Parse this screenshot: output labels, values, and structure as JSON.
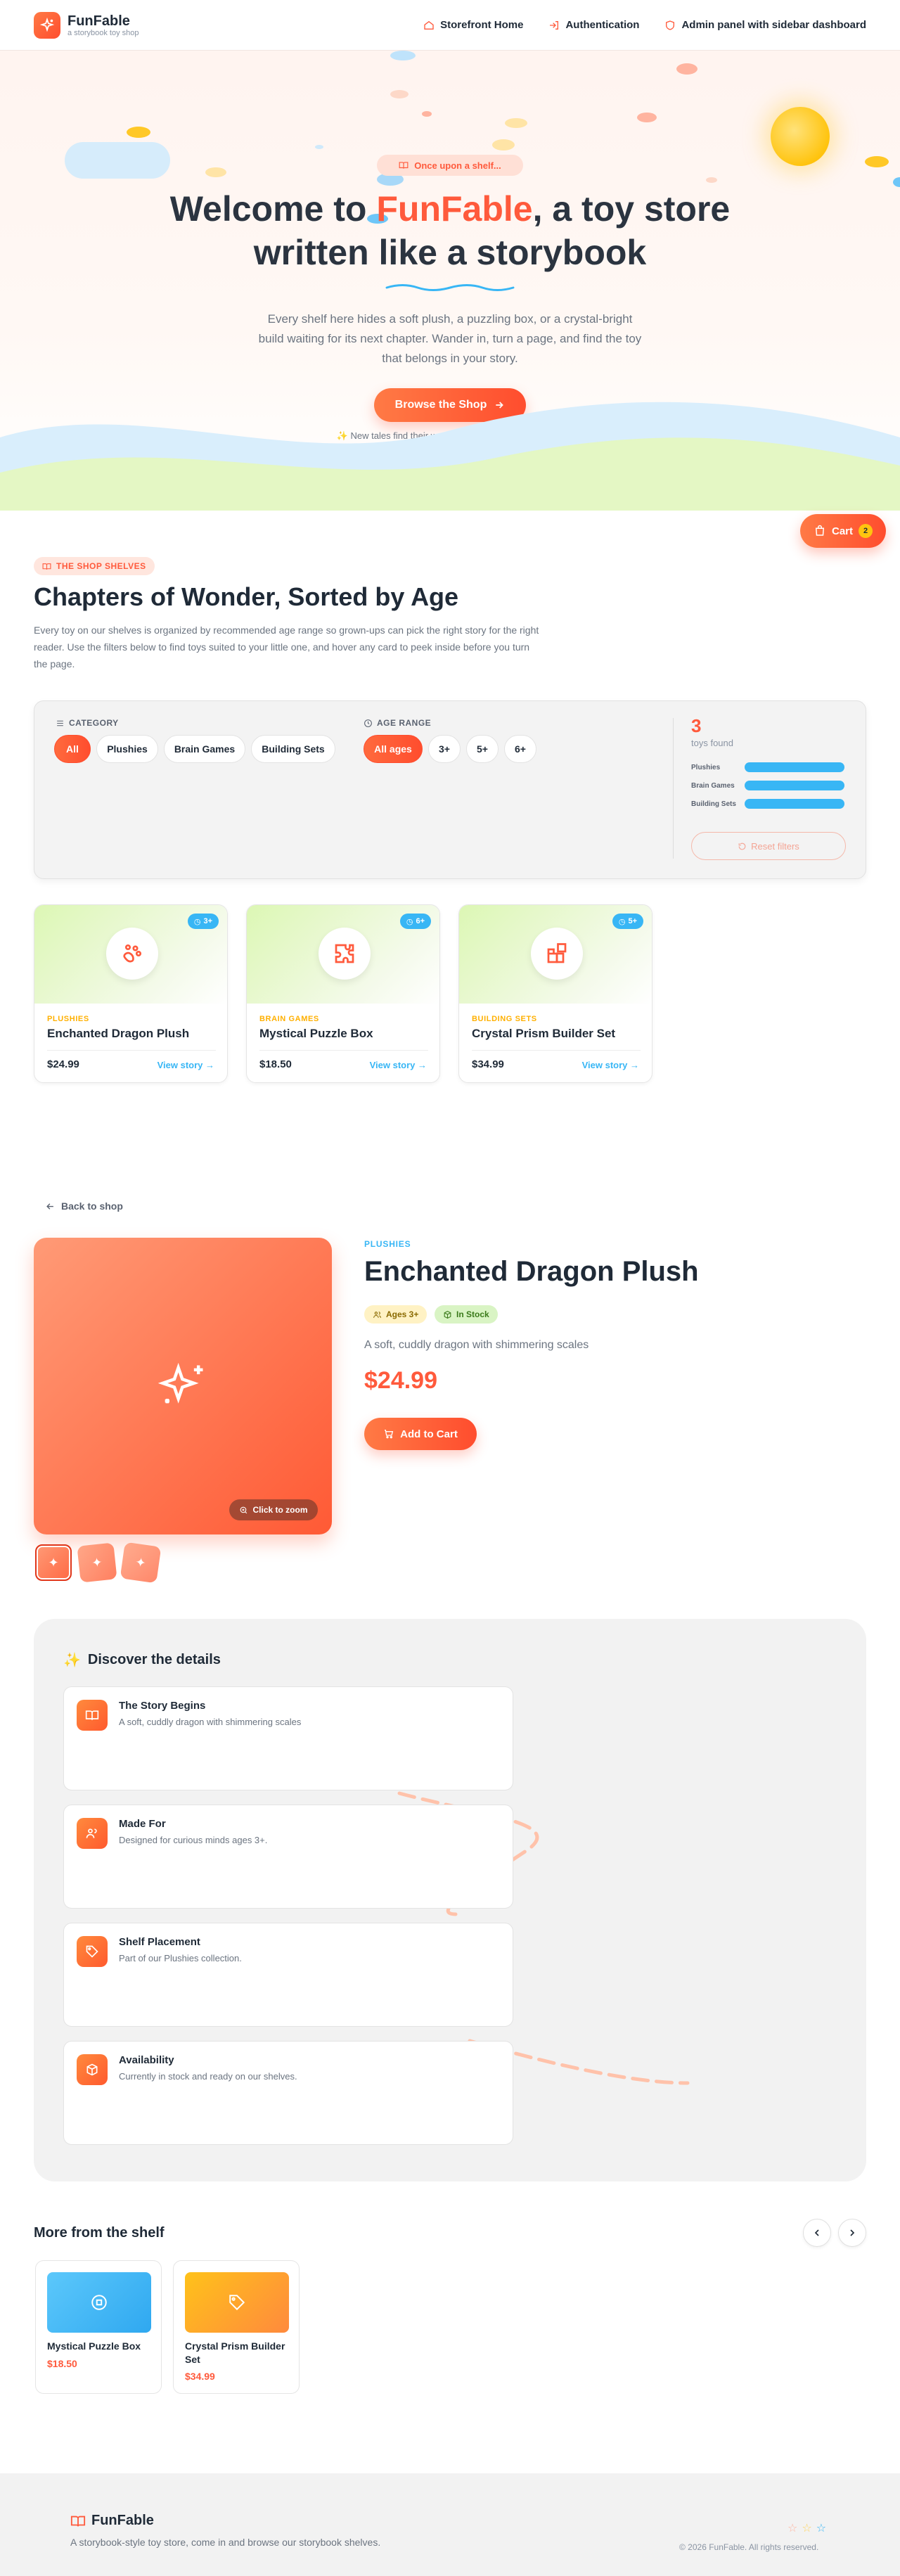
{
  "nav": {
    "brand_name": "FunFable",
    "brand_tag": "a storybook toy shop",
    "links": [
      "Storefront Home",
      "Authentication",
      "Admin panel with sidebar dashboard"
    ]
  },
  "hero": {
    "pill": "Once upon a shelf...",
    "title_pre": "Welcome to ",
    "title_accent": "FunFable",
    "title_post": ", a toy store written like a storybook",
    "subtitle": "Every shelf here hides a soft plush, a puzzling box, or a crystal-bright build waiting for its next chapter. Wander in, turn a page, and find the toy that belongs in your story.",
    "button": "Browse the Shop",
    "note": "New tales find their way to our shelves every season"
  },
  "cart": {
    "label": "Cart",
    "count": "2"
  },
  "shelves": {
    "pill": "THE SHOP SHELVES",
    "title": "Chapters of Wonder, Sorted by Age",
    "description": "Every toy on our shelves is organized by recommended age range so grown-ups can pick the right story for the right reader. Use the filters below to find toys suited to your little one, and hover any card to peek inside before you turn the page.",
    "category_label": "CATEGORY",
    "categories": [
      "All",
      "Plushies",
      "Brain Games",
      "Building Sets"
    ],
    "age_label": "AGE RANGE",
    "ages": [
      "All ages",
      "3+",
      "5+",
      "6+"
    ],
    "count": "3",
    "count_label": "toys found",
    "bars": [
      "Plushies",
      "Brain Games",
      "Building Sets"
    ],
    "reset": "Reset filters",
    "colors": {
      "accent": "#ff5a3c",
      "blue": "#38b6f5",
      "gold": "#ffb000"
    }
  },
  "products": [
    {
      "category": "PLUSHIES",
      "name": "Enchanted Dragon Plush",
      "price": "$24.99",
      "age": "3+",
      "link": "View story →"
    },
    {
      "category": "BRAIN GAMES",
      "name": "Mystical Puzzle Box",
      "price": "$18.50",
      "age": "6+",
      "link": "View story →"
    },
    {
      "category": "BUILDING SETS",
      "name": "Crystal Prism Builder Set",
      "price": "$34.99",
      "age": "5+",
      "link": "View story →"
    }
  ],
  "detail": {
    "back": "Back to shop",
    "category": "PLUSHIES",
    "title": "Enchanted Dragon Plush",
    "age_badge": "Ages 3+",
    "stock_badge": "In Stock",
    "description": "A soft, cuddly dragon with shimmering scales",
    "price": "$24.99",
    "add_button": "Add to Cart",
    "zoom": "Click to zoom"
  },
  "discover": {
    "title": "Discover the details",
    "cards": [
      {
        "title": "The Story Begins",
        "text": "A soft, cuddly dragon with shimmering scales",
        "icon": "book-icon"
      },
      {
        "title": "Made For",
        "text": "Designed for curious minds ages 3+.",
        "icon": "users-icon"
      },
      {
        "title": "Shelf Placement",
        "text": "Part of our Plushies collection.",
        "icon": "tag-icon"
      },
      {
        "title": "Availability",
        "text": "Currently in stock and ready on our shelves.",
        "icon": "box-icon"
      }
    ]
  },
  "more": {
    "title": "More from the shelf",
    "items": [
      {
        "name": "Mystical Puzzle Box",
        "price": "$18.50"
      },
      {
        "name": "Crystal Prism Builder Set",
        "price": "$34.99"
      }
    ]
  },
  "footer": {
    "brand": "FunFable",
    "tagline": "A storybook-style toy store, come in and browse our storybook shelves.",
    "copyright": "© 2026 FunFable. All rights reserved."
  }
}
